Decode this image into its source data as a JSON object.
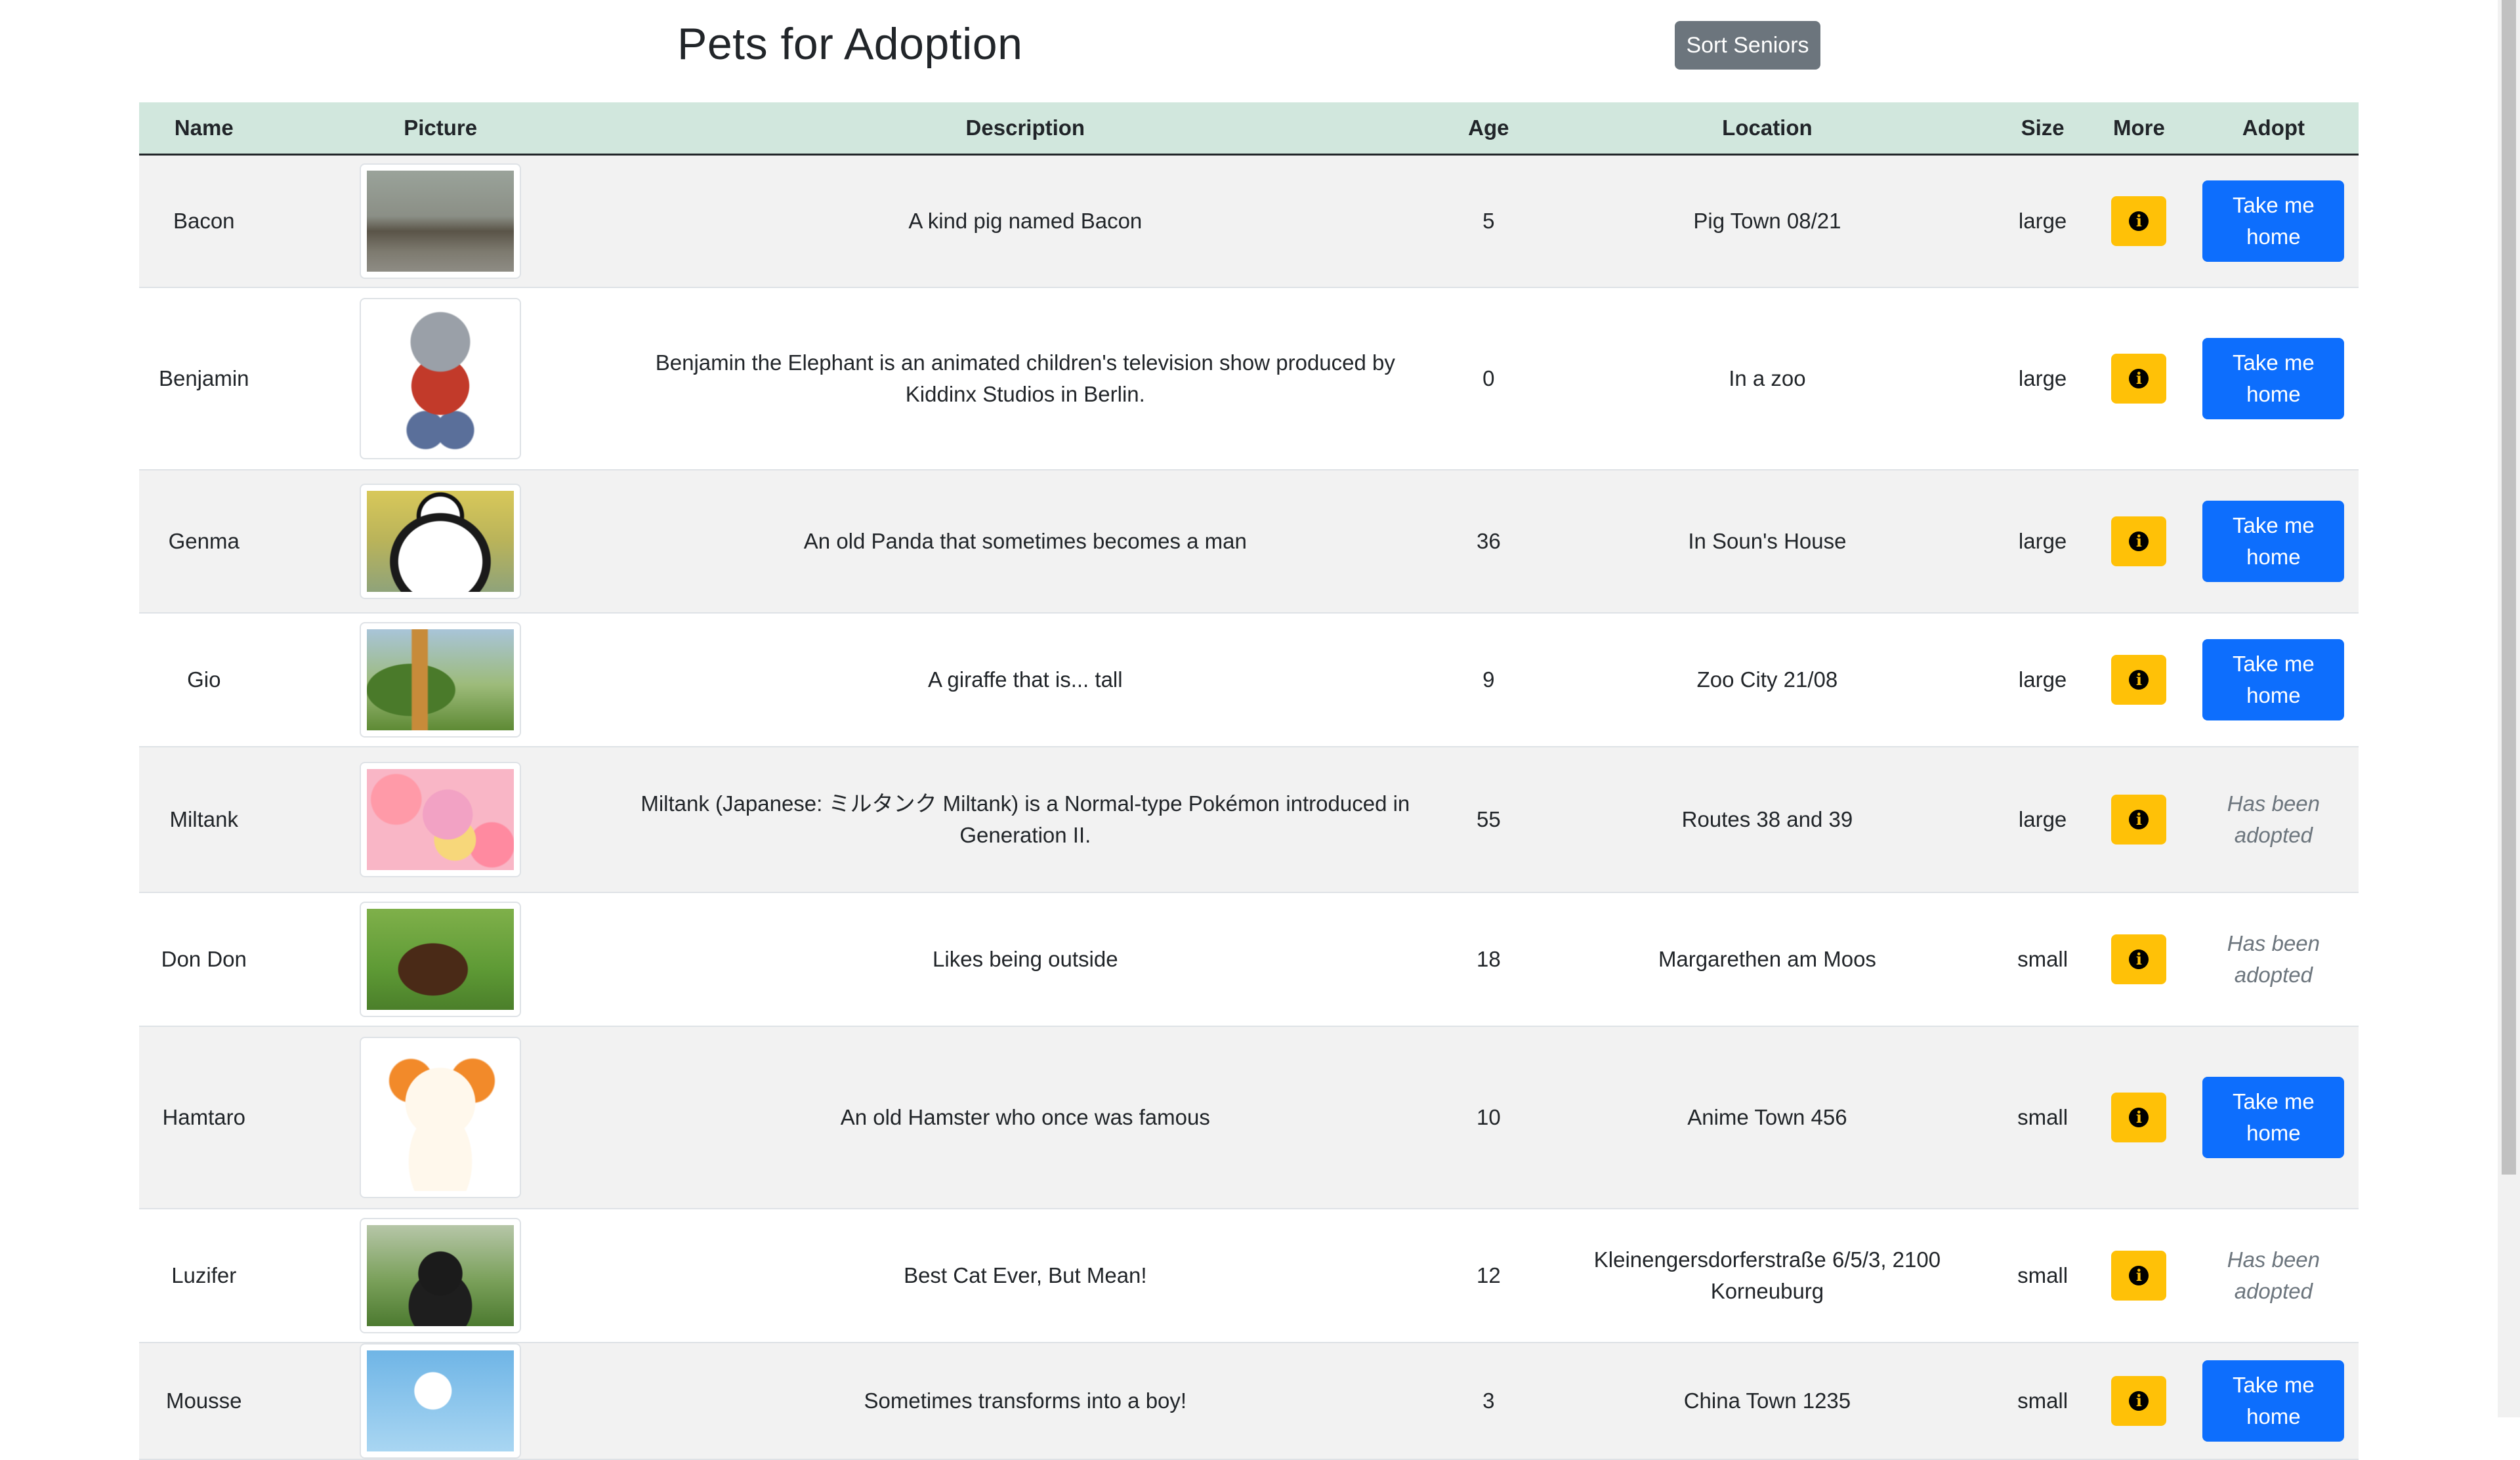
{
  "header": {
    "title": "Pets for Adoption",
    "sort_label": "Sort Seniors"
  },
  "table": {
    "columns": [
      "Name",
      "Picture",
      "Description",
      "Age",
      "Location",
      "Size",
      "More",
      "Adopt"
    ],
    "adopt_label": "Take me home",
    "adopted_label": "Has been adopted",
    "rows": [
      {
        "name": "Bacon",
        "picture": "boar-photo",
        "description": "A kind pig named Bacon",
        "age": "5",
        "location": "Pig Town 08/21",
        "size": "large",
        "adopted": false
      },
      {
        "name": "Benjamin",
        "picture": "elephant-plush-photo",
        "description": "Benjamin the Elephant is an animated children's television show produced by Kiddinx Studios in Berlin.",
        "age": "0",
        "location": "In a zoo",
        "size": "large",
        "adopted": false
      },
      {
        "name": "Genma",
        "picture": "panda-cartoon-image",
        "description": "An old Panda that sometimes becomes a man",
        "age": "36",
        "location": "In Soun's House",
        "size": "large",
        "adopted": false
      },
      {
        "name": "Gio",
        "picture": "giraffe-photo",
        "description": "A giraffe that is... tall",
        "age": "9",
        "location": "Zoo City 21/08",
        "size": "large",
        "adopted": false
      },
      {
        "name": "Miltank",
        "picture": "miltank-image",
        "description": "Miltank (Japanese: ミルタンク Miltank) is a Normal-type Pokémon introduced in Generation II.",
        "age": "55",
        "location": "Routes 38 and 39",
        "size": "large",
        "adopted": true
      },
      {
        "name": "Don Don",
        "picture": "dog-photo",
        "description": "Likes being outside",
        "age": "18",
        "location": "Margarethen am Moos",
        "size": "small",
        "adopted": true
      },
      {
        "name": "Hamtaro",
        "picture": "hamster-cartoon-image",
        "description": "An old Hamster who once was famous",
        "age": "10",
        "location": "Anime Town 456",
        "size": "small",
        "adopted": false
      },
      {
        "name": "Luzifer",
        "picture": "black-cat-photo",
        "description": "Best Cat Ever, But Mean!",
        "age": "12",
        "location": "Kleinengersdorferstraße 6/5/3, 2100 Korneuburg",
        "size": "small",
        "adopted": true
      },
      {
        "name": "Mousse",
        "picture": "duck-cartoon-image",
        "description": "Sometimes transforms into a boy!",
        "age": "3",
        "location": "China Town 1235",
        "size": "small",
        "adopted": false
      }
    ]
  }
}
